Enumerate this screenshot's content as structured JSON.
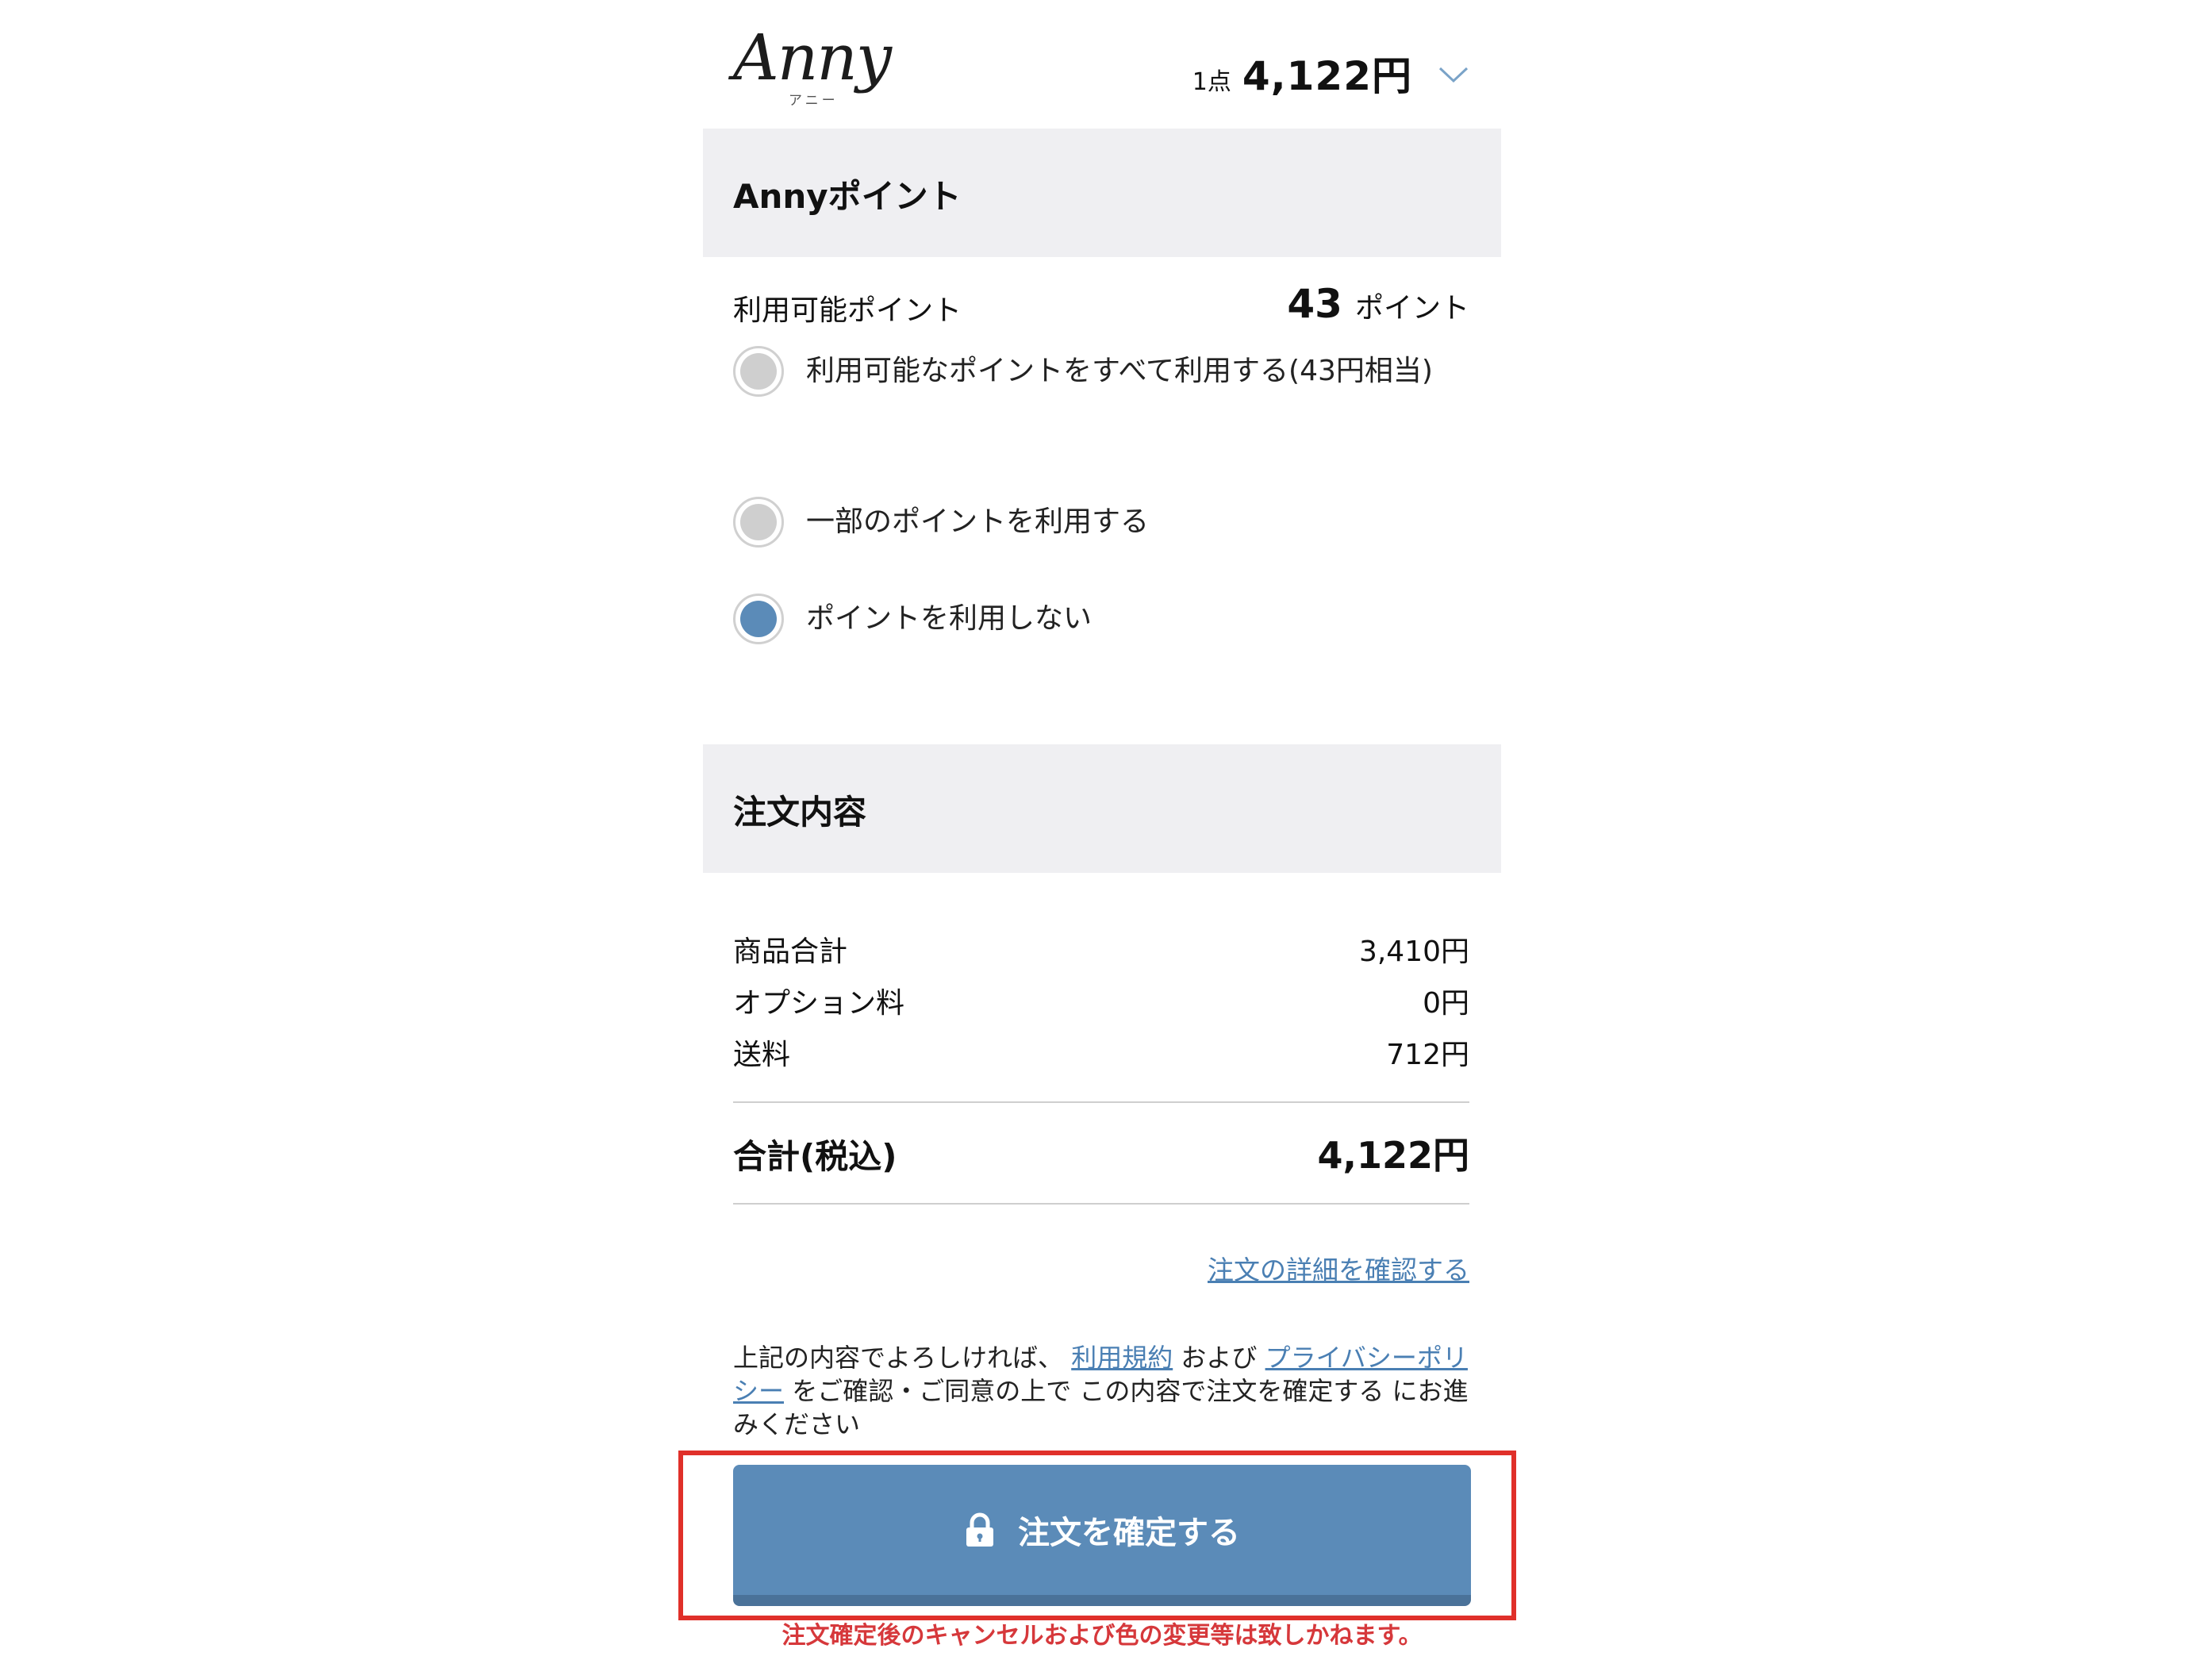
{
  "header": {
    "logo_text": "Anny",
    "logo_kana": "アニー",
    "item_count": "1点",
    "total": "4,122円",
    "chevron_icon": "chevron-down-icon"
  },
  "points_section": {
    "title": "Annyポイント",
    "available_label": "利用可能ポイント",
    "available_value": "43",
    "available_unit": "ポイント",
    "options": [
      {
        "label": "利用可能なポイントをすべて利用する(43円相当)",
        "selected": false
      },
      {
        "label": "一部のポイントを利用する",
        "selected": false
      },
      {
        "label": "ポイントを利用しない",
        "selected": true
      }
    ]
  },
  "order_section": {
    "title": "注文内容",
    "rows": [
      {
        "label": "商品合計",
        "value": "3,410円"
      },
      {
        "label": "オプション料",
        "value": "0円"
      },
      {
        "label": "送料",
        "value": "712円"
      }
    ],
    "total_label": "合計(税込)",
    "total_value": "4,122円",
    "detail_link": "注文の詳細を確認する"
  },
  "consent": {
    "text1": "上記の内容でよろしければ、",
    "terms_link": "利用規約",
    "text2": "および",
    "privacy_link": "プライバシーポリシー",
    "text3": "をご確認・ご同意の上で この内容で注文を確定する にお進みください"
  },
  "confirm": {
    "button_label": "注文を確定する",
    "icon": "lock-icon",
    "warning": "注文確定後のキャンセルおよび色の変更等は致しかねます。"
  },
  "colors": {
    "accent": "#5b8bb8",
    "section_bg": "#efeff2",
    "warning": "#d6383b",
    "highlight_border": "#e0302a",
    "link": "#4a7fb3"
  }
}
